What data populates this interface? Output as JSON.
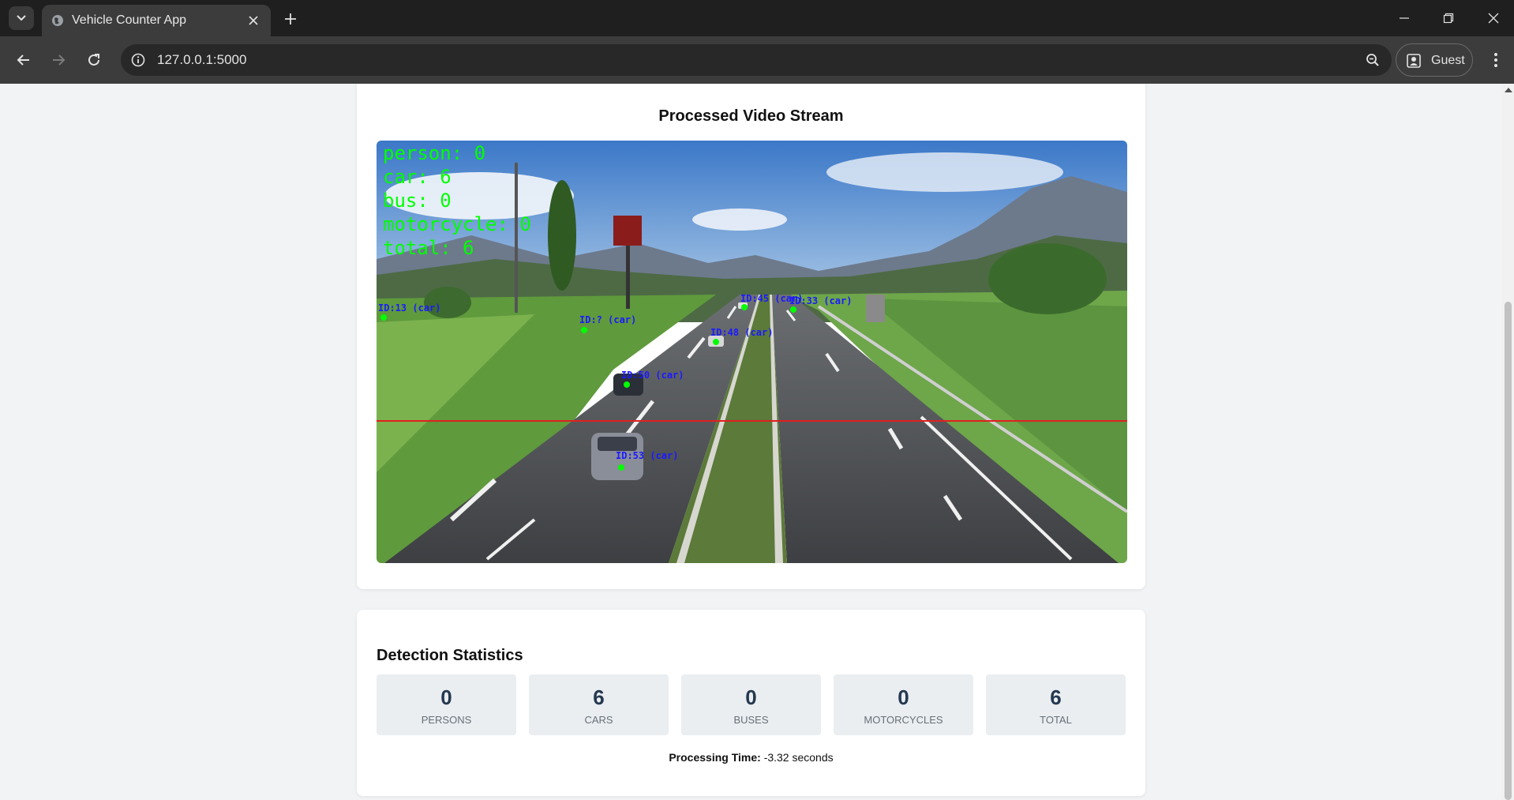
{
  "browser": {
    "tab_title": "Vehicle Counter App",
    "url": "127.0.0.1:5000",
    "profile_label": "Guest"
  },
  "video": {
    "title": "Processed Video Stream",
    "overlay_counts": [
      "person: 0",
      "car: 6",
      "bus: 0",
      "motorcycle: 0",
      "total: 6"
    ],
    "detections": [
      {
        "label": "ID:13 (car)"
      },
      {
        "label": "ID:? (car)"
      },
      {
        "label": "ID:45 (car)"
      },
      {
        "label": "ID:33 (car)"
      },
      {
        "label": "ID:48 (car)"
      },
      {
        "label": "ID:50 (car)"
      },
      {
        "label": "ID:53 (car)"
      }
    ],
    "counting_line_color": "#e02020",
    "overlay_text_color": "#00ff00",
    "box_label_color": "#1a1aff"
  },
  "stats": {
    "title": "Detection Statistics",
    "items": [
      {
        "value": "0",
        "label": "PERSONS"
      },
      {
        "value": "6",
        "label": "CARS"
      },
      {
        "value": "0",
        "label": "BUSES"
      },
      {
        "value": "0",
        "label": "MOTORCYCLES"
      },
      {
        "value": "6",
        "label": "TOTAL"
      }
    ],
    "processing_label": "Processing Time:",
    "processing_value": "-3.32 seconds"
  }
}
